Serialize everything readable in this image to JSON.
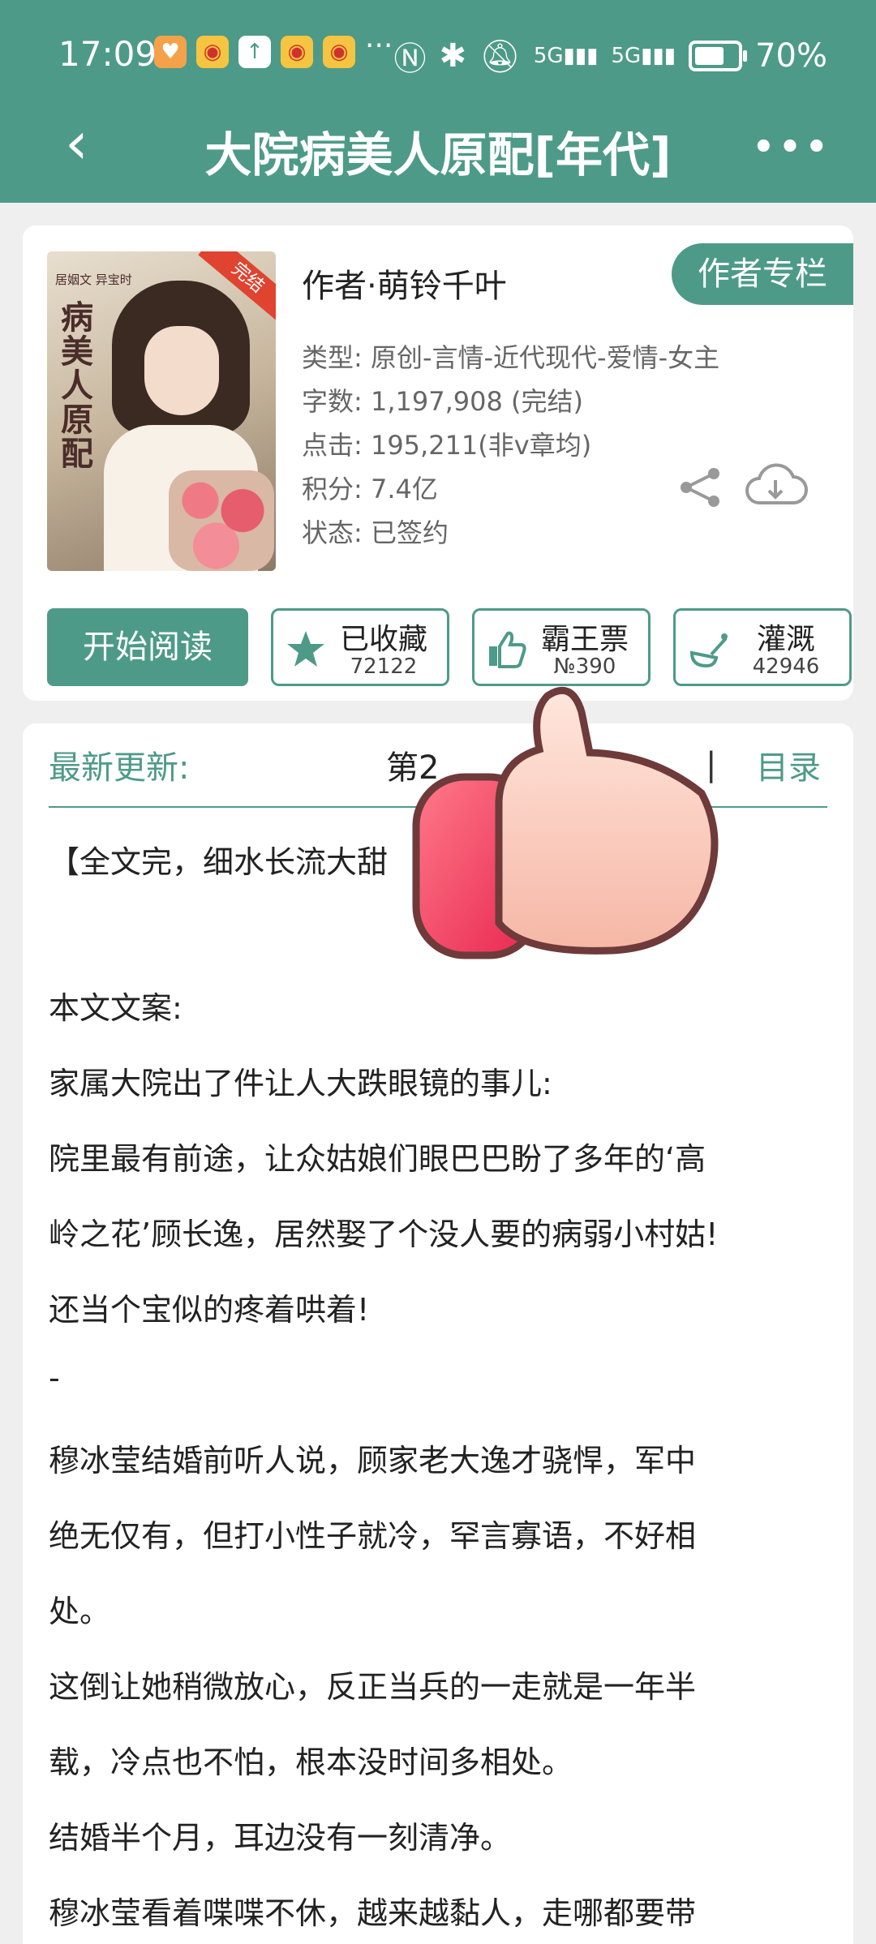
{
  "status_bar": {
    "time": "17:09",
    "more": "···",
    "network1": "5G",
    "network2": "5G",
    "battery": "70%",
    "battery_level": 0.7
  },
  "header": {
    "back_icon": "chevron-left-icon",
    "title": "大院病美人原配[年代]",
    "more": "•••"
  },
  "book": {
    "cover_title": "病美人原配",
    "cover_badge": "完结",
    "cover_small": "居姻文 异宝时",
    "author": "作者·萌铃千叶",
    "author_column": "作者专栏",
    "type": "类型: 原创-言情-近代现代-爱情-女主",
    "words": "字数: 1,197,908 (完结)",
    "clicks": "点击: 195,211(非v章均)",
    "score": "积分: 7.4亿",
    "state": "状态: 已签约"
  },
  "actions": {
    "read": "开始阅读",
    "fav_label": "已收藏",
    "fav_count": "72122",
    "ticket_label": "霸王票",
    "ticket_rank": "№390",
    "water_label": "灌溉",
    "water_count": "42946"
  },
  "content": {
    "latest_label": "最新更新:",
    "latest_value": "第2",
    "separator": "|",
    "toc": "目录",
    "lines": [
      "【全文完，细水长流大甜",
      "本文文案:",
      "家属大院出了件让人大跌眼镜的事儿:",
      "院里最有前途，让众姑娘们眼巴巴盼了多年的‘高",
      "岭之花’顾长逸，居然娶了个没人要的病弱小村姑!",
      "还当个宝似的疼着哄着!",
      "-",
      "穆冰莹结婚前听人说，顾家老大逸才骁悍，军中",
      "绝无仅有，但打小性子就冷，罕言寡语，不好相",
      "处。",
      "这倒让她稍微放心，反正当兵的一走就是一年半",
      "载，冷点也不怕，根本没时间多相处。",
      "结婚半个月，耳边没有一刻清净。",
      "穆冰莹看着喋喋不休，越来越黏人，走哪都要带"
    ]
  }
}
